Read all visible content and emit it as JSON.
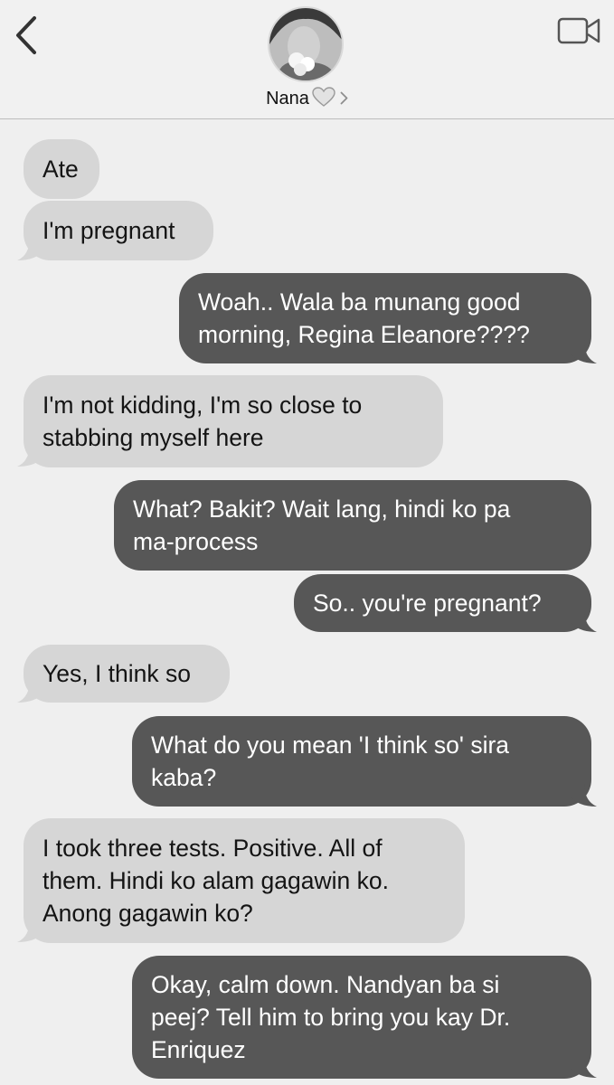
{
  "header": {
    "contact_name": "Nana",
    "icons": {
      "back": "chevron-left-icon",
      "video": "video-camera-icon",
      "heart": "heart-icon",
      "chevron": "chevron-right-icon"
    }
  },
  "messages": [
    {
      "direction": "incoming",
      "text": "Ate"
    },
    {
      "direction": "incoming",
      "text": "I'm pregnant"
    },
    {
      "direction": "outgoing",
      "lines": [
        "Woah.. Wala ba munang good",
        "morning, Regina Eleanore????"
      ]
    },
    {
      "direction": "incoming",
      "lines": [
        "I'm not kidding, I'm so close to",
        "stabbing myself here"
      ]
    },
    {
      "direction": "outgoing",
      "lines": [
        "What? Bakit? Wait lang, hindi ko pa",
        "ma-process"
      ]
    },
    {
      "direction": "outgoing",
      "text": "So.. you're pregnant?"
    },
    {
      "direction": "incoming",
      "text": "Yes, I think so"
    },
    {
      "direction": "outgoing",
      "lines": [
        "What do you mean 'I think so' sira",
        "kaba?"
      ]
    },
    {
      "direction": "incoming",
      "lines": [
        "I took three tests. Positive. All of",
        "them. Hindi ko alam gagawin ko.",
        "Anong gagawin ko?"
      ]
    },
    {
      "direction": "outgoing",
      "lines": [
        "Okay, calm down. Nandyan ba si",
        "peej? Tell him to bring you kay Dr.",
        "Enriquez"
      ]
    }
  ],
  "colors": {
    "background": "#efefef",
    "incoming_bubble": "#d6d6d6",
    "outgoing_bubble": "#575757"
  }
}
